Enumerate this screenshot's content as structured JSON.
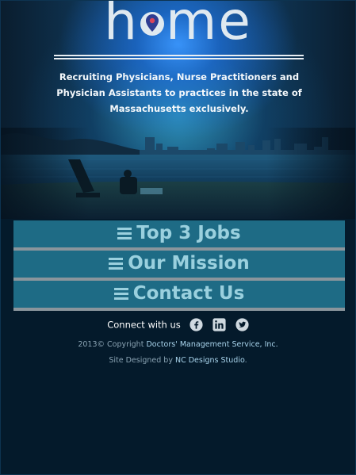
{
  "header": {
    "logo_before": "h",
    "logo_after": "me",
    "tagline": "Recruiting Physicians, Nurse Practitioners and Physician Assistants to practices in the state of Massachusetts exclusively."
  },
  "menu": {
    "items": [
      {
        "label": "Top 3 Jobs",
        "icon": "hamburger-icon"
      },
      {
        "label": "Our Mission",
        "icon": "hamburger-icon"
      },
      {
        "label": "Contact Us",
        "icon": "hamburger-icon"
      }
    ]
  },
  "footer": {
    "connect_label": "Connect with us",
    "social": [
      "facebook-icon",
      "linkedin-icon",
      "twitter-icon"
    ],
    "copyright_prefix": "2013© Copyright",
    "copyright_company": "Doctors' Management Service, Inc.",
    "designed_prefix": "Site Designed by",
    "designer": "NC Designs Studio",
    "designed_suffix": "."
  },
  "colors": {
    "background": "#041a2b",
    "menu_bg": "#1e6b85",
    "menu_text": "#9ad0de",
    "pin": "#2e3d92",
    "link": "#a9d4ec"
  }
}
